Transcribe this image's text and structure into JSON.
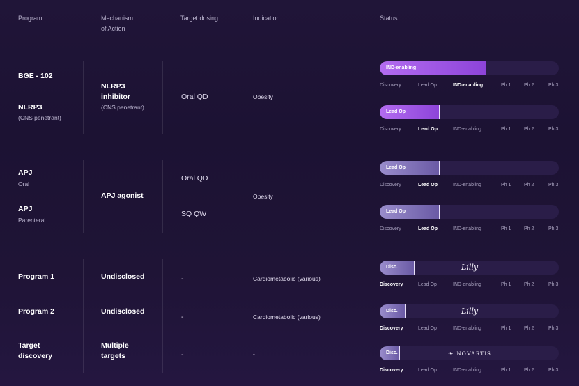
{
  "headers": {
    "program": "Program",
    "mechanism_1": "Mechanism",
    "mechanism_2": "of Action",
    "dosing": "Target dosing",
    "indication": "Indication",
    "status": "Status"
  },
  "stage_labels": [
    "Discovery",
    "Lead Op",
    "IND-enabling",
    "Ph 1",
    "Ph 2",
    "Ph 3"
  ],
  "colors": {
    "accent_purple": "#a65ae8",
    "lavender": "#8d7fc4",
    "track": "#2a1d48"
  },
  "groups": {
    "g1": {
      "program_a_name": "BGE - 102",
      "program_b_name": "NLRP3",
      "program_b_sub": "(CNS penetrant)",
      "mechanism_line1": "NLRP3",
      "mechanism_line2": "inhibitor",
      "mechanism_sub": "(CNS penetrant)",
      "dosing": "Oral QD",
      "indication": "Obesity"
    },
    "g2": {
      "program_a_name": "APJ",
      "program_a_sub": "Oral",
      "program_b_name": "APJ",
      "program_b_sub": "Parenteral",
      "mechanism": "APJ agonist",
      "dosing_a": "Oral QD",
      "dosing_b": "SQ QW",
      "indication": "Obesity"
    },
    "g3": {
      "p1_name": "Program 1",
      "p1_mechanism": "Undisclosed",
      "p1_dosing": "-",
      "p1_indication": "Cardiometabolic (various)",
      "p2_name": "Program 2",
      "p2_mechanism": "Undisclosed",
      "p2_dosing": "-",
      "p2_indication": "Cardiometabolic (various)",
      "p3_name_line1": "Target",
      "p3_name_line2": "discovery",
      "p3_mechanism_line1": "Multiple",
      "p3_mechanism_line2": "targets",
      "p3_dosing": "-",
      "p3_indication": "-"
    }
  },
  "status_bars": [
    {
      "label": "IND-enabling",
      "stage_index": 2,
      "progress": 0.59,
      "style": "purple",
      "partner": ""
    },
    {
      "label": "Lead Op",
      "stage_index": 1,
      "progress": 0.33,
      "style": "purple",
      "partner": ""
    },
    {
      "label": "Lead Op",
      "stage_index": 1,
      "progress": 0.33,
      "style": "lavender",
      "partner": ""
    },
    {
      "label": "Lead Op",
      "stage_index": 1,
      "progress": 0.33,
      "style": "lavender",
      "partner": ""
    },
    {
      "label": "Disc.",
      "stage_index": 0,
      "progress": 0.19,
      "style": "lavender",
      "partner": "Lilly"
    },
    {
      "label": "Disc.",
      "stage_index": 0,
      "progress": 0.14,
      "style": "lavender",
      "partner": "Lilly"
    },
    {
      "label": "Disc.",
      "stage_index": 0,
      "progress": 0.11,
      "style": "lavender",
      "partner": "NOVARTIS"
    }
  ]
}
